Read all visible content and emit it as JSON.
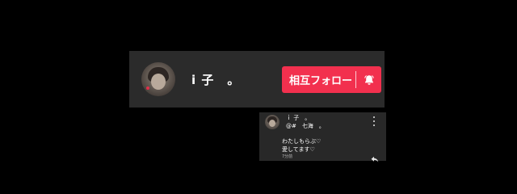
{
  "profile": {
    "name": "i 子　。",
    "follow_label": "相互フォロー",
    "follow_color": "#f2304e",
    "bell_icon": "bell-icon"
  },
  "comment": {
    "author": "ｉ 子　。",
    "mention": "@#　七海　。",
    "lines": [
      "わたしもらぶ♡",
      "愛してます♡"
    ],
    "time": "7分前",
    "more_icon": "more-vertical-icon",
    "reply_icon": "reply-icon"
  }
}
